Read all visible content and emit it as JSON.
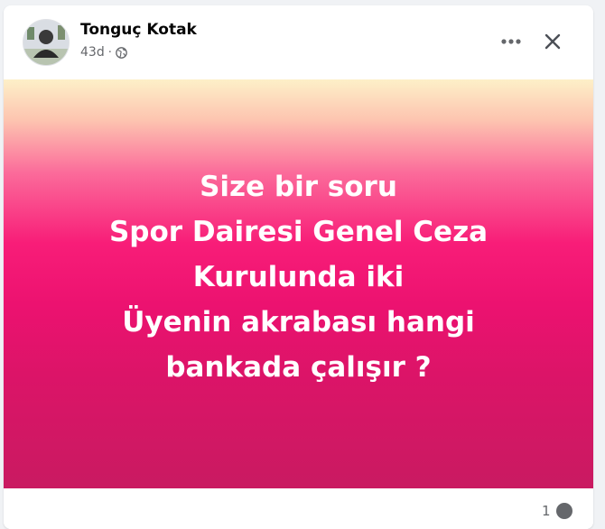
{
  "post": {
    "author": "Tonguç Kotak",
    "time": "43d",
    "separator": "·",
    "privacy_icon": "globe-icon",
    "text_lines": [
      "Size bir soru",
      "Spor Dairesi Genel Ceza",
      "Kurulunda iki",
      "Üyenin akrabası hangi",
      "bankada çalışır ?"
    ],
    "background_colors": [
      "#fdf0c8",
      "#f81d78",
      "#c91a61"
    ]
  },
  "actions": {
    "more_icon": "more-horizontal-icon",
    "close_icon": "close-icon"
  },
  "footer": {
    "reaction_count": "1",
    "reaction_icon": "reaction-icon"
  }
}
